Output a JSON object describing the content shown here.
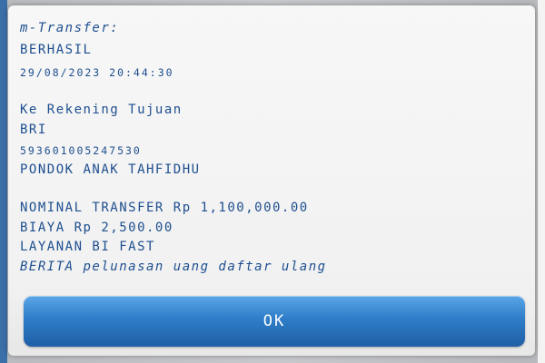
{
  "dialog": {
    "lines": [
      "m-Transfer:",
      "BERHASIL",
      "29/08/2023  20:44:30",
      "Ke Rekening Tujuan",
      "BRI",
      "593601005247530",
      "PONDOK ANAK TAHFIDHU",
      "NOMINAL TRANSFER Rp 1,100,000.00",
      "BIAYA Rp 2,500.00",
      "LAYANAN BI FAST",
      "BERITA pelunasan uang daftar ulang"
    ],
    "ok_label": "OK"
  },
  "colors": {
    "text": "#1e4f8f",
    "button": "#2f7dc9",
    "dialog_bg": "#f3f3f3"
  }
}
